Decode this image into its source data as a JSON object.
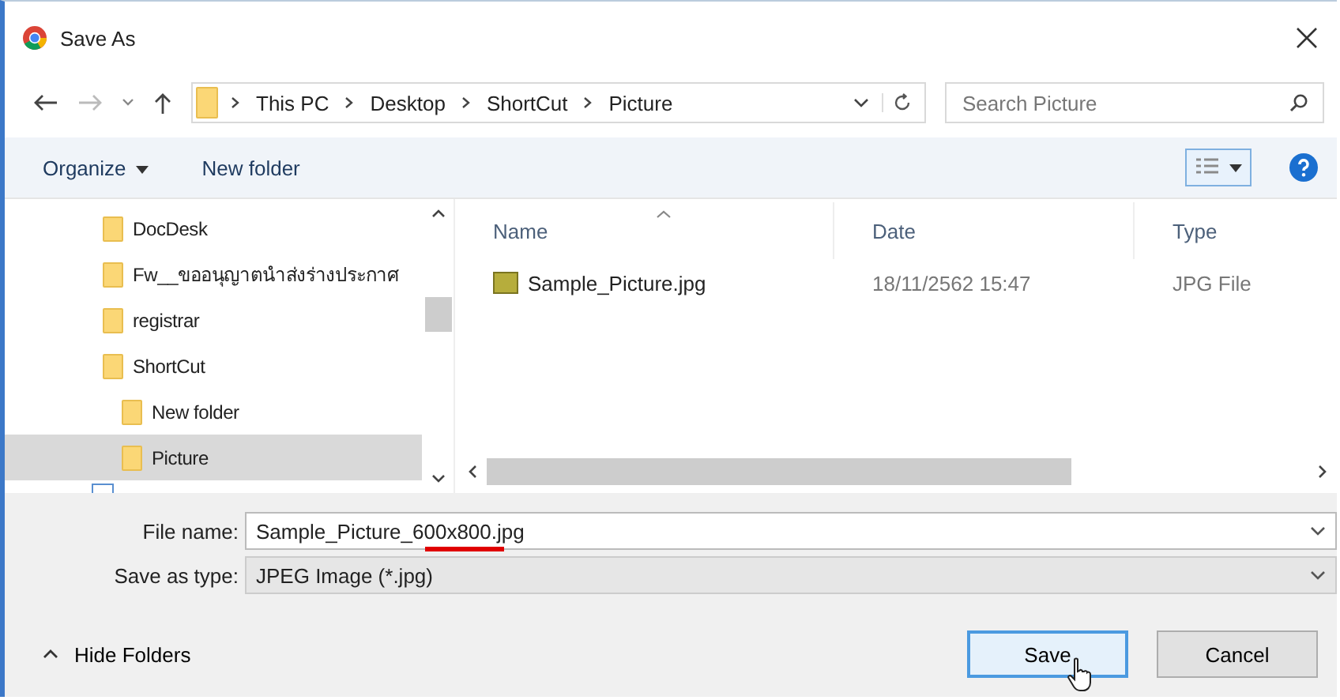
{
  "window": {
    "title": "Save As"
  },
  "breadcrumb": [
    "This PC",
    "Desktop",
    "ShortCut",
    "Picture"
  ],
  "search": {
    "placeholder": "Search Picture"
  },
  "toolbar": {
    "organize": "Organize",
    "new_folder": "New folder"
  },
  "tree": [
    {
      "label": "DocDesk",
      "selected": false
    },
    {
      "label": "Fw__ขออนุญาตนำส่งร่างประกาศ",
      "selected": false
    },
    {
      "label": "registrar",
      "selected": false
    },
    {
      "label": "ShortCut",
      "selected": false,
      "children": [
        {
          "label": "New folder",
          "selected": false
        },
        {
          "label": "Picture",
          "selected": true
        }
      ]
    }
  ],
  "columns": [
    "Name",
    "Date",
    "Type"
  ],
  "files": [
    {
      "name": "Sample_Picture.jpg",
      "date": "18/11/2562 15:47",
      "type": "JPG File"
    }
  ],
  "file_name": {
    "label": "File name:",
    "value": "Sample_Picture_600x800.jpg"
  },
  "save_type": {
    "label": "Save as type:",
    "value": "JPEG Image (*.jpg)"
  },
  "hide_folders": "Hide Folders",
  "buttons": [
    {
      "label": "Save",
      "kind": "primary"
    },
    {
      "label": "Cancel",
      "kind": "normal"
    }
  ]
}
